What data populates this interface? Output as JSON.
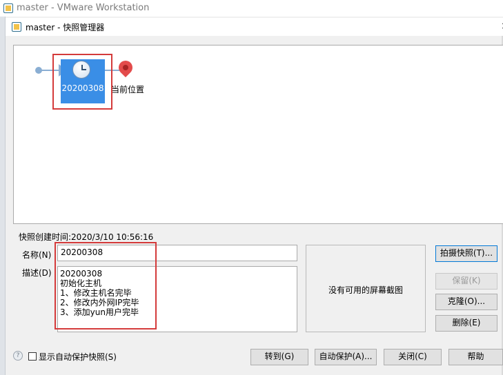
{
  "window": {
    "outer_title": "master - VMware Workstation",
    "dialog_title": "master - 快照管理器",
    "close_glyph": "×"
  },
  "tree": {
    "snapshot_label": "20200308",
    "current_position_label": "当前位置",
    "snapshot_icon": "clock-icon",
    "current_icon": "map-pin-icon"
  },
  "details": {
    "created_text": "快照创建时间:2020/3/10 10:56:16",
    "name_label": "名称(N)",
    "desc_label": "描述(D)",
    "name_value": "20200308",
    "description_lines": [
      "20200308",
      "初始化主机",
      "1、修改主机名完毕",
      "2、修改内外网IP完毕",
      "3、添加yun用户完毕"
    ],
    "no_screenshot_text": "没有可用的屏幕截图"
  },
  "side_buttons": {
    "take_snapshot": "拍摄快照(T)...",
    "keep": "保留(K)",
    "clone": "克隆(O)...",
    "delete": "删除(E)"
  },
  "footer": {
    "show_auto_label": "显示自动保护快照(S)",
    "show_auto_checked": false,
    "goto": "转到(G)",
    "autoprotect": "自动保护(A)...",
    "close": "关闭(C)",
    "help": "帮助"
  },
  "colors": {
    "selected_node": "#3a8ee6",
    "annotation_red": "#d43a3a",
    "timeline": "#8aaed3",
    "pin": "#e34b4b"
  }
}
